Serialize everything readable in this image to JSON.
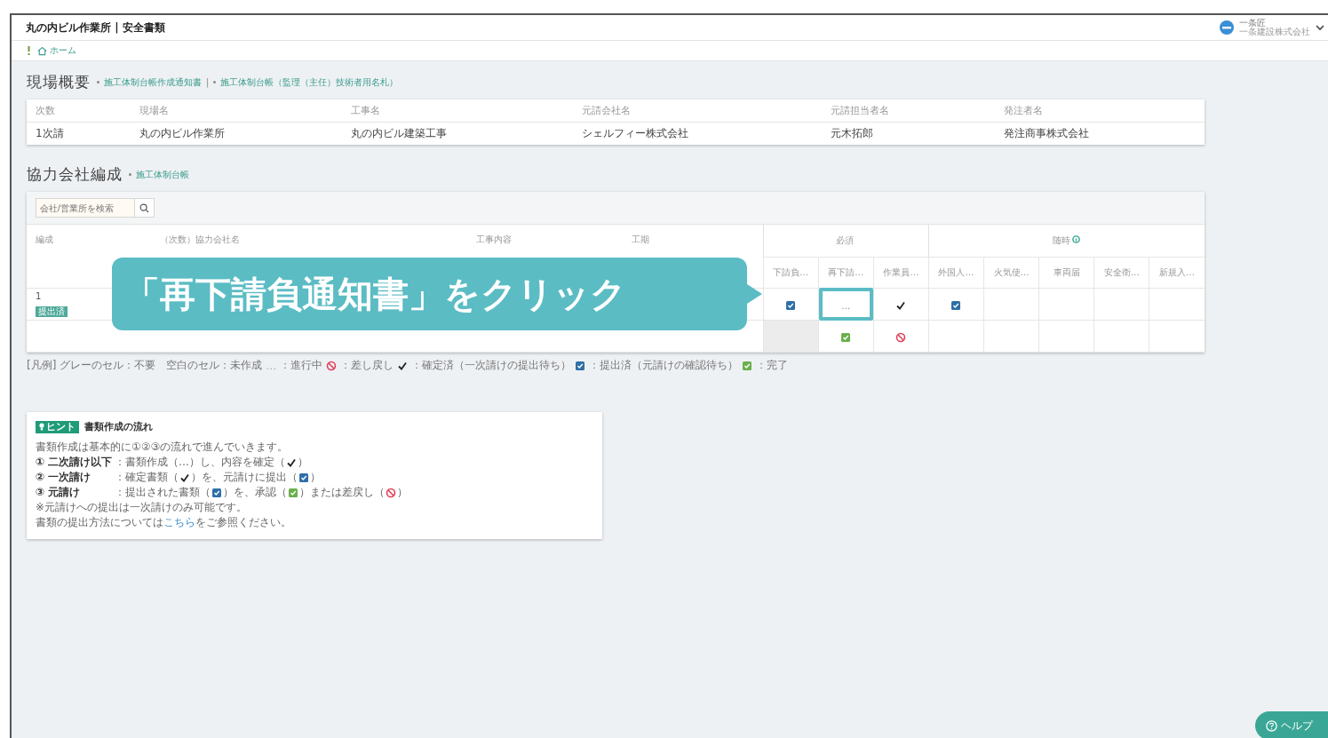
{
  "header": {
    "title": "丸の内ビル作業所 | 安全書類",
    "user_name": "一条匠",
    "user_company": "一条建設株式会社"
  },
  "breadcrumb": {
    "label": "ホーム"
  },
  "site_overview": {
    "title": "現場概要",
    "links": [
      "施工体制台帳作成通知書",
      "施工体制台帳（監理（主任）技術者用名札）"
    ],
    "separator": "|",
    "columns": [
      "次数",
      "現場名",
      "工事名",
      "元請会社名",
      "元請担当者名",
      "発注者名"
    ],
    "rows": [
      [
        "1次請",
        "丸の内ビル作業所",
        "丸の内ビル建築工事",
        "シェルフィー株式会社",
        "元木拓郎",
        "発注商事株式会社"
      ]
    ]
  },
  "partners": {
    "title": "協力会社編成",
    "links": [
      "施工体制台帳"
    ],
    "search": {
      "placeholder": "会社/営業所を検索"
    },
    "columns": [
      "編成",
      "（次数）協力会社名",
      "工事内容",
      "工期"
    ],
    "groups": [
      {
        "label": "必須",
        "info": false,
        "columns": [
          "下請負…",
          "再下請…",
          "作業員…"
        ]
      },
      {
        "label": "随時",
        "info": true,
        "columns": [
          "外国人…",
          "火気使…",
          "車両届",
          "安全衛…",
          "新規入…"
        ]
      }
    ],
    "rows": [
      {
        "index": "1",
        "badge": "提出済",
        "cells": [
          {
            "kind": "submitted",
            "highlighted": false
          },
          {
            "kind": "pending",
            "text": "…",
            "highlighted": true
          },
          {
            "kind": "confirmed",
            "highlighted": false
          },
          {
            "kind": "submitted",
            "highlighted": false
          },
          {
            "kind": "none",
            "highlighted": false
          },
          {
            "kind": "none",
            "highlighted": false
          },
          {
            "kind": "none",
            "highlighted": false
          },
          {
            "kind": "none",
            "highlighted": false
          }
        ]
      },
      {
        "cells": [
          {
            "kind": "gray",
            "highlighted": false
          },
          {
            "kind": "approved",
            "highlighted": false
          },
          {
            "kind": "returned",
            "highlighted": false
          },
          {
            "kind": "none",
            "highlighted": false
          },
          {
            "kind": "none",
            "highlighted": false
          },
          {
            "kind": "none",
            "highlighted": false
          },
          {
            "kind": "none",
            "highlighted": false
          },
          {
            "kind": "none",
            "highlighted": false
          }
        ]
      }
    ]
  },
  "legend": [
    {
      "kind": "text",
      "text": "[凡例] グレーのセル：不要　空白のセル：未作成"
    },
    {
      "kind": "pending",
      "text": "…"
    },
    {
      "kind": "text",
      "text": "：進行中"
    },
    {
      "kind": "returned"
    },
    {
      "kind": "text",
      "text": "：差し戻し"
    },
    {
      "kind": "confirmed"
    },
    {
      "kind": "text",
      "text": "：確定済（一次請けの提出待ち）"
    },
    {
      "kind": "submitted"
    },
    {
      "kind": "text",
      "text": "：提出済（元請けの確認待ち）"
    },
    {
      "kind": "approved"
    },
    {
      "kind": "text",
      "text": "：完了"
    }
  ],
  "hint": {
    "badge": "ヒント",
    "title": "書類作成の流れ",
    "intro": "書類作成は基本的に①②③の流れで進んでいきます。",
    "steps": [
      {
        "label": "① 二次請け以下",
        "segments": [
          {
            "kind": "text",
            "text": "：書類作成（…）し、内容を確定（"
          },
          {
            "kind": "confirmed"
          },
          {
            "kind": "text",
            "text": "）"
          }
        ]
      },
      {
        "label": "② 一次請け",
        "segments": [
          {
            "kind": "text",
            "text": "：確定書類（"
          },
          {
            "kind": "confirmed"
          },
          {
            "kind": "text",
            "text": "）を、元請けに提出（"
          },
          {
            "kind": "submitted"
          },
          {
            "kind": "text",
            "text": "）"
          }
        ]
      },
      {
        "label": "③ 元請け",
        "segments": [
          {
            "kind": "text",
            "text": "：提出された書類（"
          },
          {
            "kind": "submitted"
          },
          {
            "kind": "text",
            "text": "）を、承認（"
          },
          {
            "kind": "approved"
          },
          {
            "kind": "text",
            "text": "）または差戻し（"
          },
          {
            "kind": "returned"
          },
          {
            "kind": "text",
            "text": "）"
          }
        ]
      }
    ],
    "note": "※元請けへの提出は一次請けのみ可能です。",
    "footer_before": "書類の提出方法については",
    "footer_link": "こちら",
    "footer_after": "をご参照ください。"
  },
  "callout": {
    "text": "「再下請負通知書」をクリック"
  },
  "help_button": {
    "label": "ヘルプ"
  }
}
